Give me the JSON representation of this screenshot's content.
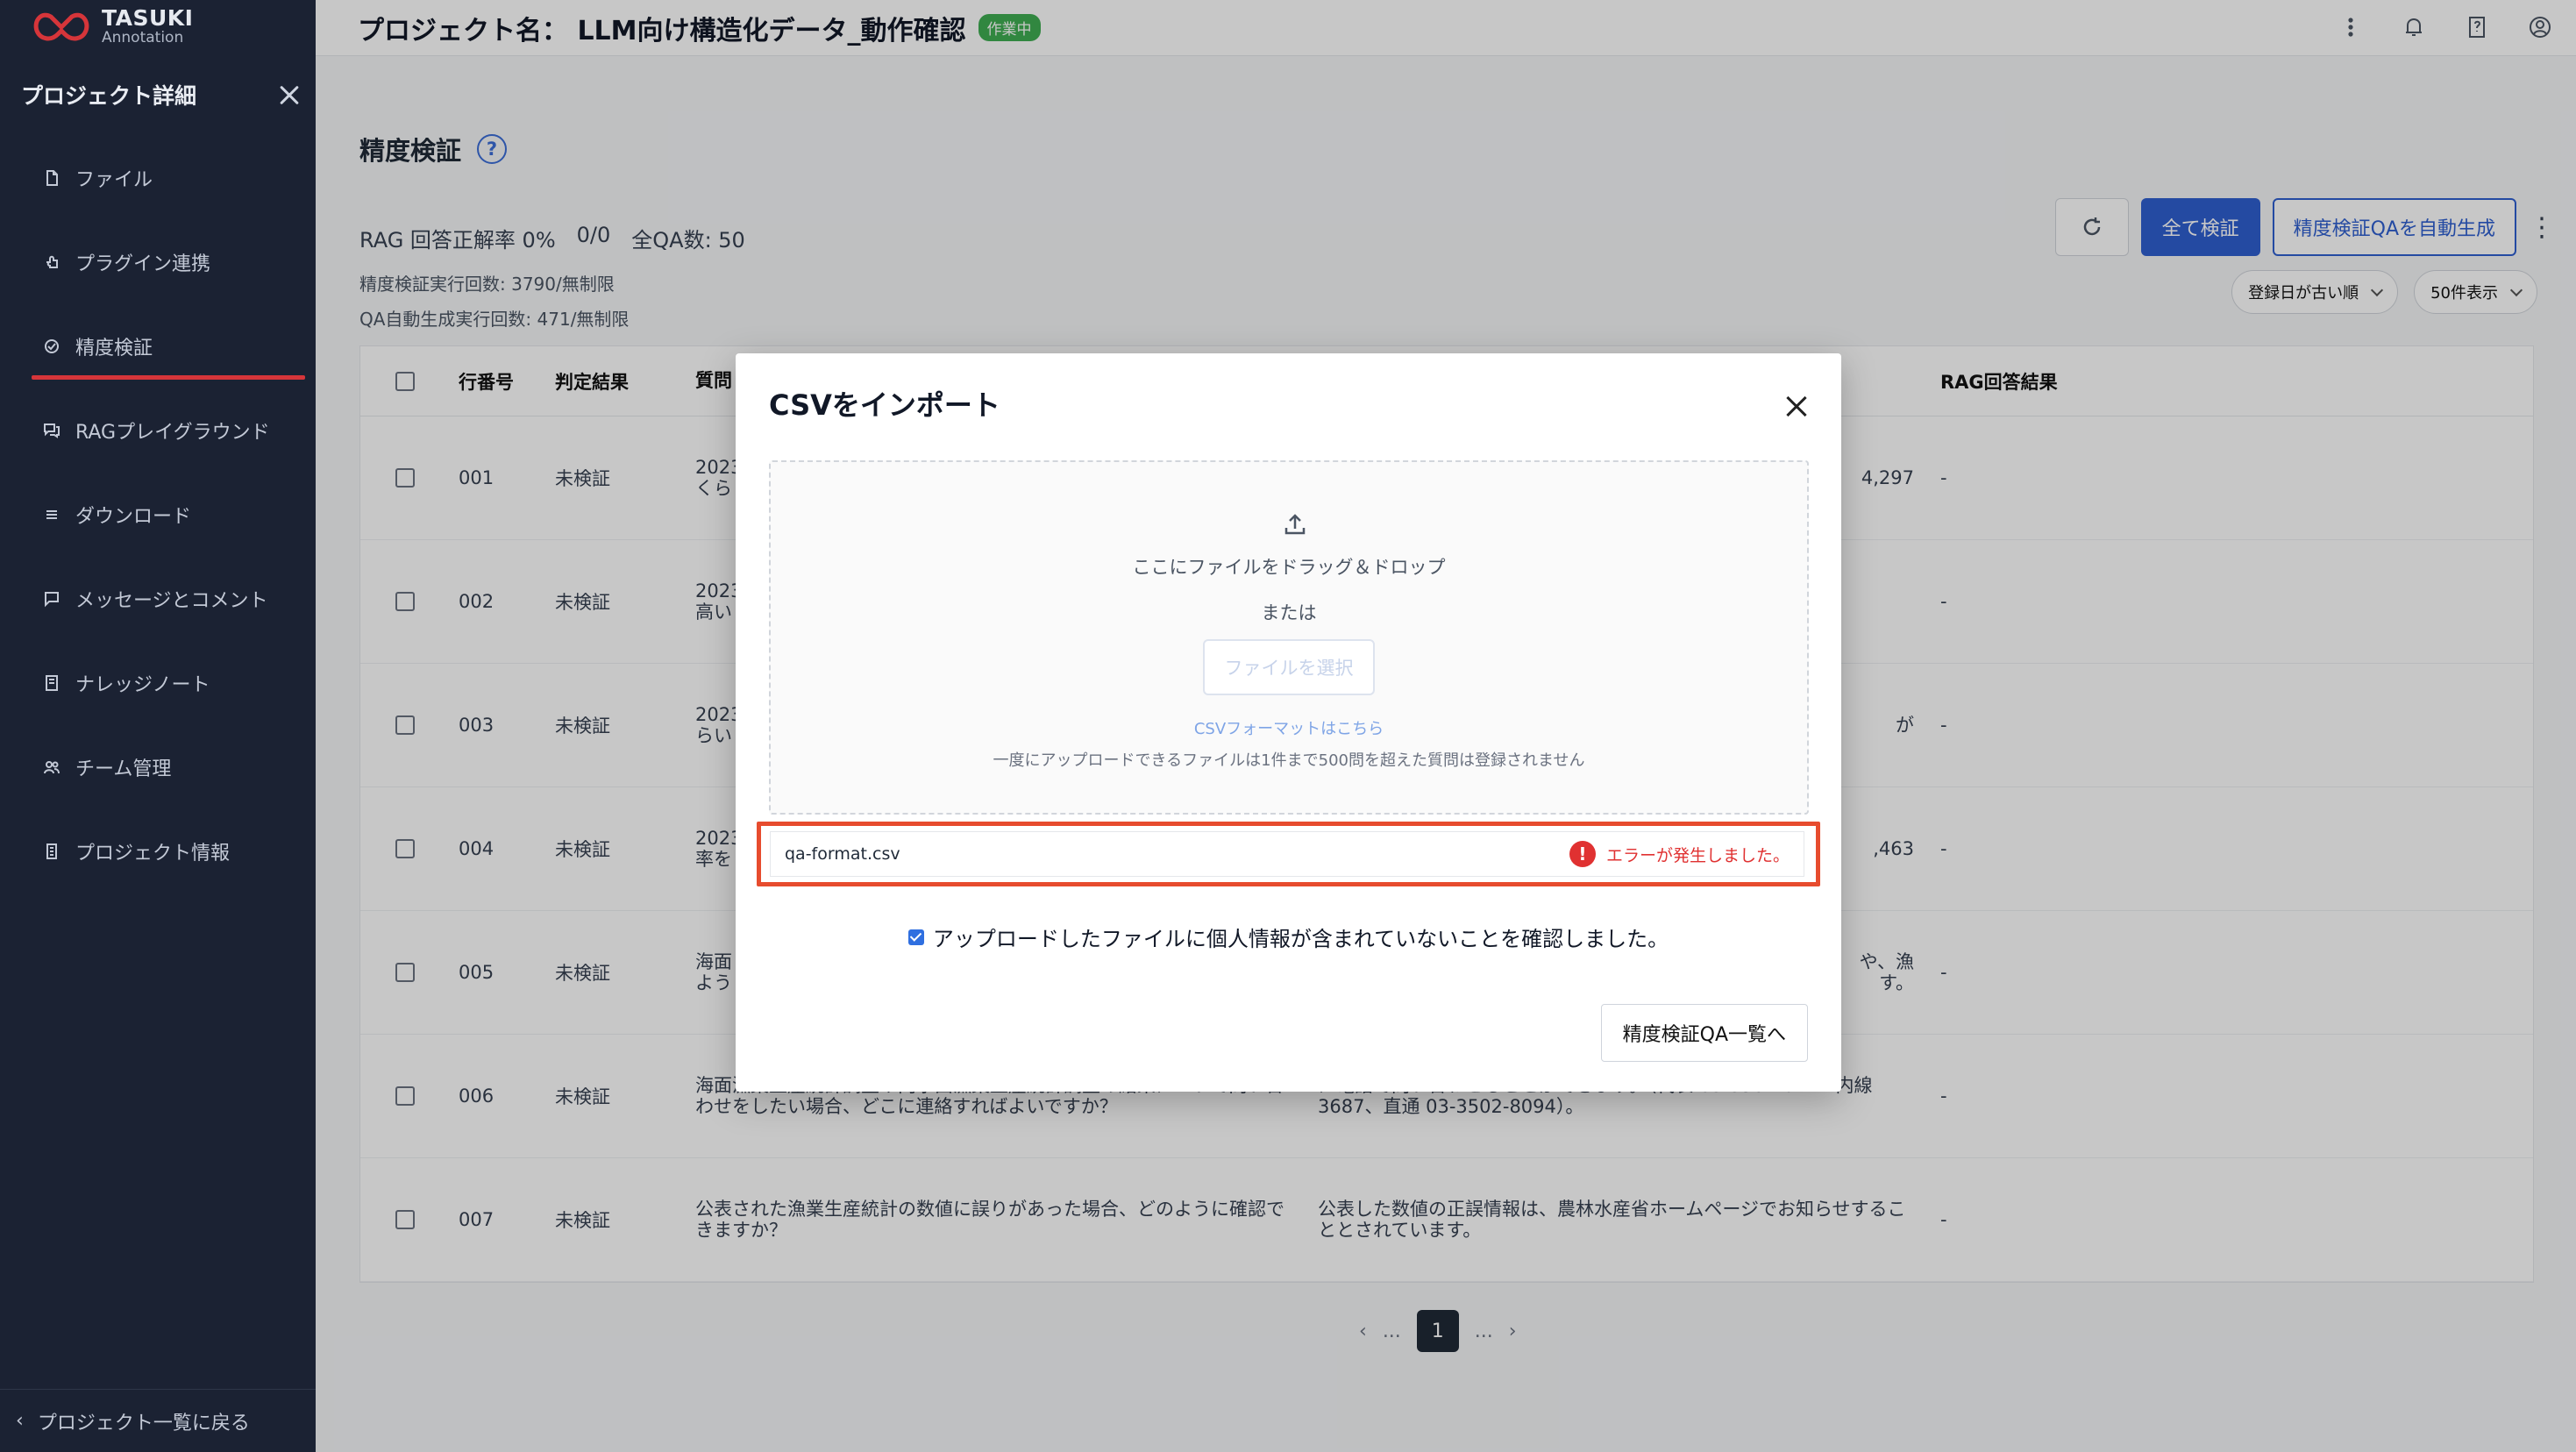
{
  "logo": {
    "line1": "TASUKI",
    "line2": "Annotation"
  },
  "sidebar": {
    "title": "プロジェクト詳細",
    "items": [
      {
        "label": "ファイル",
        "icon": "file-icon"
      },
      {
        "label": "プラグイン連携",
        "icon": "plugin-icon"
      },
      {
        "label": "精度検証",
        "icon": "accuracy-icon",
        "active": true
      },
      {
        "label": "RAGプレイグラウンド",
        "icon": "chat-icon"
      },
      {
        "label": "ダウンロード",
        "icon": "list-icon"
      },
      {
        "label": "メッセージとコメント",
        "icon": "message-icon"
      },
      {
        "label": "ナレッジノート",
        "icon": "note-icon"
      },
      {
        "label": "チーム管理",
        "icon": "team-icon"
      },
      {
        "label": "プロジェクト情報",
        "icon": "info-icon"
      }
    ],
    "back_label": "プロジェクト一覧に戻る"
  },
  "header": {
    "project_name": "プロジェクト名： LLM向け構造化データ_動作確認",
    "status": "作業中"
  },
  "page": {
    "title": "精度検証",
    "rag_rate": "RAG 回答正解率 0%",
    "ratio": "0/0",
    "total_qa": "全QA数: 50",
    "verify_count": "精度検証実行回数: 3790/無制限",
    "autogen_count": "QA自動生成実行回数: 471/無制限",
    "btn_verify_all": "全て検証",
    "btn_autogen": "精度検証QAを自動生成",
    "sort_select": "登録日が古い順",
    "per_page_select": "50件表示"
  },
  "table": {
    "headers": {
      "no": "行番号",
      "judge": "判定結果",
      "question": "質問",
      "rag": "RAG回答結果"
    },
    "rows": [
      {
        "no": "001",
        "judge": "未検証",
        "q": "2023\nくら",
        "a": "4,297",
        "rag": "-"
      },
      {
        "no": "002",
        "judge": "未検証",
        "q": "2023\n高い",
        "a": "",
        "rag": "-"
      },
      {
        "no": "003",
        "judge": "未検証",
        "q": "2023\nらい",
        "a": "が",
        "rag": "-"
      },
      {
        "no": "004",
        "judge": "未検証",
        "q": "2023\n率を",
        "a": ",463",
        "rag": "-"
      },
      {
        "no": "005",
        "judge": "未検証",
        "q": "海面\nよう",
        "a": "や、漁\nす。",
        "rag": "-"
      },
      {
        "no": "006",
        "judge": "未検証",
        "q": "海面漁業生産統計調査や内水面漁業生産統計調査の結果について問い合わせをしたい場合、どこに連絡すればよいですか？",
        "a": "に電話で問い合わせることができます。（代表 03-3502-8111 内線3687、直通 03-3502-8094）。",
        "rag": "-"
      },
      {
        "no": "007",
        "judge": "未検証",
        "q": "公表された漁業生産統計の数値に誤りがあった場合、どのように確認できますか？",
        "a": "公表した数値の正誤情報は、農林水産省ホームページでお知らせすることとされています。",
        "rag": "-"
      }
    ]
  },
  "pagination": {
    "current": "1",
    "ellipsis": "..."
  },
  "modal": {
    "title": "CSVをインポート",
    "drop_text": "ここにファイルをドラッグ＆ドロップ",
    "or_text": "または",
    "select_button": "ファイルを選択",
    "csv_link": "CSVフォーマットはこちら",
    "note": "一度にアップロードできるファイルは1件まで500問を超えた質問は登録されません",
    "file_name": "qa-format.csv",
    "error_message": "エラーが発生しました。",
    "confirm_text": "アップロードしたファイルに個人情報が含まれていないことを確認しました。",
    "confirm_checked": true,
    "next_button": "精度検証QA一覧へ"
  }
}
